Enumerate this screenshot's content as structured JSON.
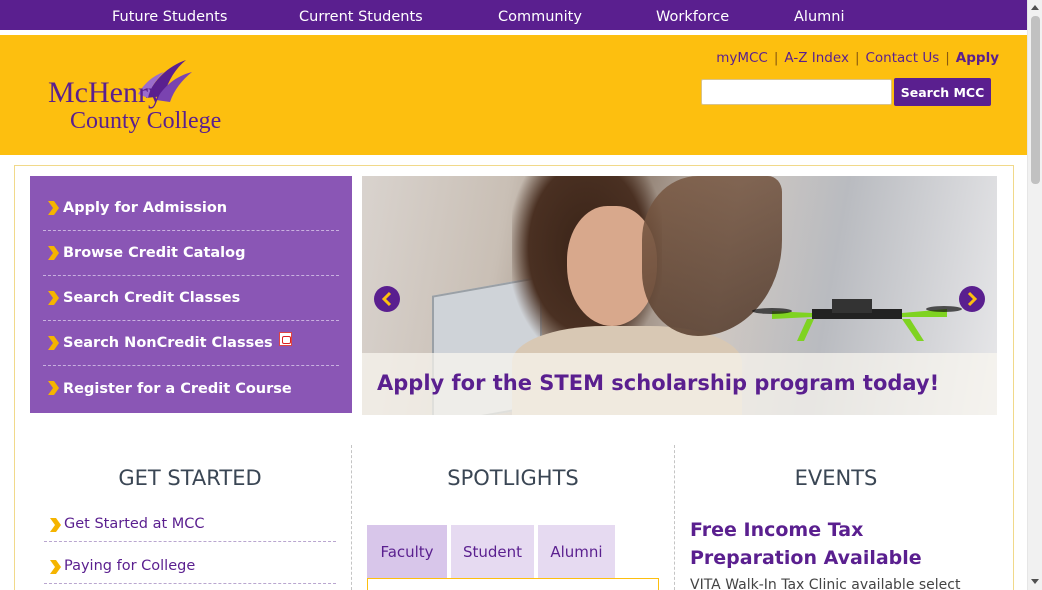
{
  "top_nav": {
    "items": [
      "Future Students",
      "Current Students",
      "Community",
      "Workforce",
      "Alumni"
    ]
  },
  "header": {
    "logo": {
      "line1": "McHenry",
      "line2": "County College"
    },
    "utility_links": [
      "myMCC",
      "A-Z Index",
      "Contact Us",
      "Apply"
    ],
    "search": {
      "value": "",
      "button_label": "Search MCC"
    }
  },
  "quick_links": [
    {
      "label": "Apply for Admission",
      "icon": "chevron-right-icon"
    },
    {
      "label": "Browse Credit Catalog",
      "icon": "chevron-right-icon"
    },
    {
      "label": "Search Credit Classes",
      "icon": "chevron-right-icon"
    },
    {
      "label": "Search NonCredit Classes",
      "icon": "chevron-right-icon",
      "badge_icon": "pdf-icon"
    },
    {
      "label": "Register for a Credit Course",
      "icon": "chevron-right-icon"
    }
  ],
  "hero": {
    "caption": "Apply for the STEM scholarship program today!",
    "prev_icon": "arrow-left-icon",
    "next_icon": "arrow-right-icon"
  },
  "columns": {
    "get_started": {
      "title": "GET STARTED",
      "links": [
        "Get Started at MCC",
        "Paying for College"
      ]
    },
    "spotlights": {
      "title": "SPOTLIGHTS",
      "tabs": [
        "Faculty",
        "Student",
        "Alumni"
      ],
      "active_tab": "Faculty"
    },
    "events": {
      "title": "EVENTS",
      "event_title": "Free Income Tax Preparation Available",
      "event_desc": "VITA Walk-In Tax Clinic available select"
    }
  },
  "colors": {
    "brand_purple": "#5a1f8f",
    "brand_gold": "#fdbf0f",
    "panel_purple": "#8a56b5",
    "chevron_gold": "#f5b400"
  }
}
